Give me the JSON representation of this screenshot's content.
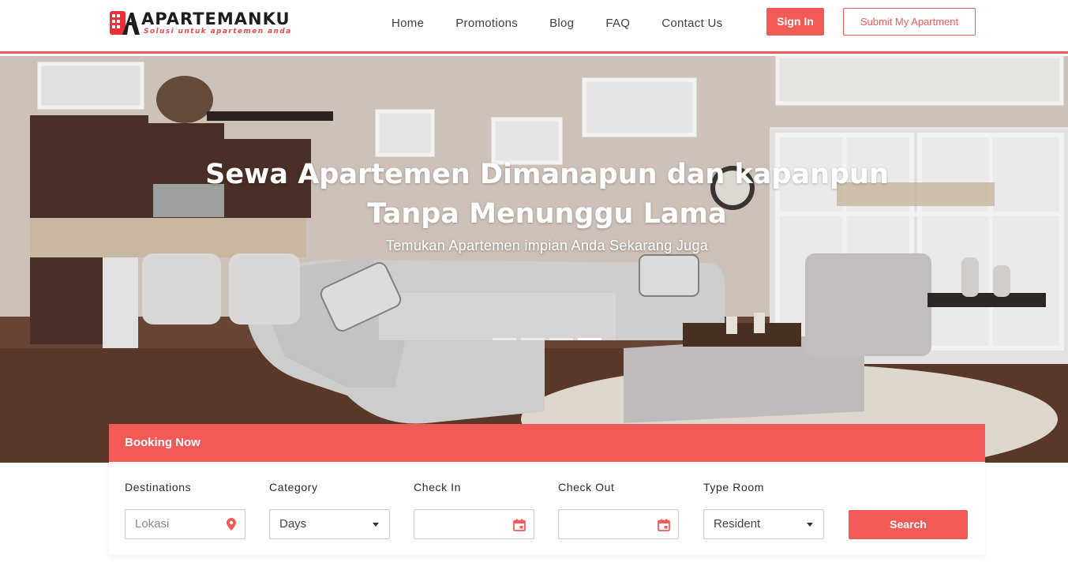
{
  "brand": {
    "name": "APARTEMANKU",
    "tagline": "Solusi untuk apartemen anda",
    "accent": "#f25a58"
  },
  "nav": {
    "items": [
      {
        "label": "Home"
      },
      {
        "label": "Promotions"
      },
      {
        "label": "Blog"
      },
      {
        "label": "FAQ"
      },
      {
        "label": "Contact Us"
      }
    ],
    "signin_label": "Sign In",
    "submit_label": "Submit My Apartment"
  },
  "hero": {
    "title_line1": "Sewa Apartemen Dimanapun dan kapanpun",
    "title_line2": "Tanpa Menunggu Lama",
    "subtitle": "Temukan Apartemen impian Anda Sekarang Juga",
    "slides_total": 4,
    "active_slide": 4
  },
  "booking": {
    "title": "Booking Now",
    "destinations": {
      "label": "Destinations",
      "placeholder": "Lokasi",
      "icon": "map-pin-icon"
    },
    "category": {
      "label": "Category",
      "value": "Days"
    },
    "checkin": {
      "label": "Check In",
      "value": "",
      "icon": "calendar-icon"
    },
    "checkout": {
      "label": "Check Out",
      "value": "",
      "icon": "calendar-icon"
    },
    "type_room": {
      "label": "Type Room",
      "value": "Resident"
    },
    "search_label": "Search"
  }
}
